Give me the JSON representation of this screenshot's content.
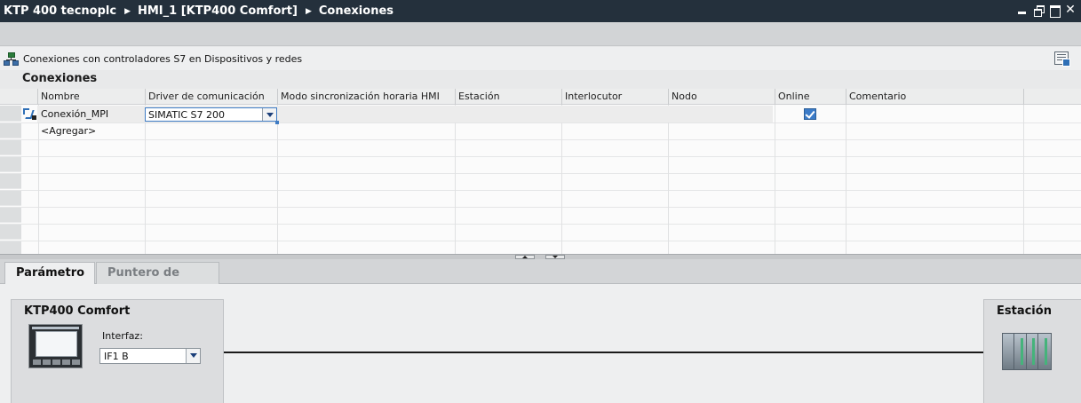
{
  "titlebar": {
    "breadcrumbs": [
      "KTP 400 tecnoplc",
      "HMI_1 [KTP400 Comfort]",
      "Conexiones"
    ],
    "window_controls": [
      "minimize-icon",
      "restore-icon",
      "maximize-icon",
      "close-icon"
    ]
  },
  "infobar": {
    "icon": "network-devices-icon",
    "text": "Conexiones con controladores S7 en Dispositivos y redes"
  },
  "table": {
    "title": "Conexiones",
    "columns": [
      "Nombre",
      "Driver de comunicación",
      "Modo sincronización horaria HMI",
      "Estación",
      "Interlocutor",
      "Nodo",
      "Online",
      "Comentario"
    ],
    "rows": [
      {
        "icon": "connection-icon",
        "nombre": "Conexión_MPI",
        "driver": "SIMATIC S7 200",
        "modo": "",
        "estacion": "",
        "interlocutor": "",
        "nodo": "",
        "online": true,
        "comentario": ""
      }
    ],
    "add_row_label": "<Agregar>"
  },
  "tabs": [
    {
      "label": "Parámetro",
      "active": true
    },
    {
      "label": "Puntero de área",
      "active": false
    }
  ],
  "params": {
    "device_title": "KTP400 Comfort",
    "interface_label": "Interfaz:",
    "interface_value": "IF1 B",
    "station_title": "Estación"
  },
  "colors": {
    "titlebar_bg": "#24303c",
    "accent_blue": "#3b7bc8",
    "plc_status_green": "#45b37b"
  }
}
